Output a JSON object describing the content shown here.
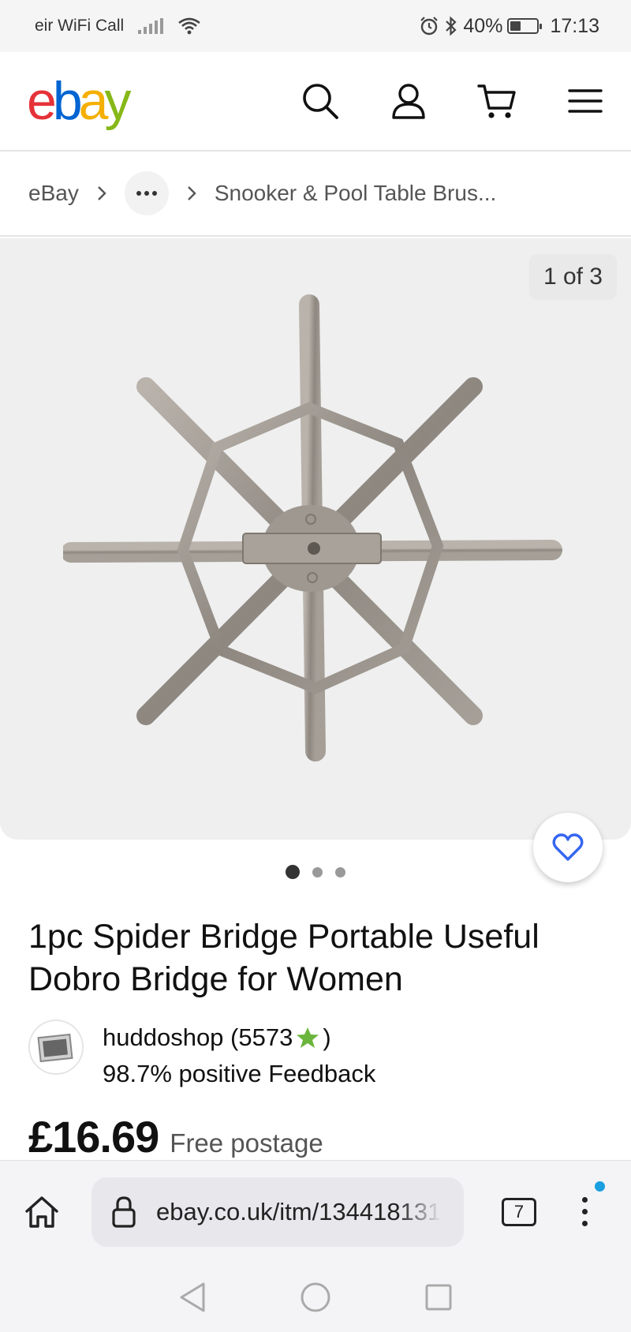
{
  "status_bar": {
    "carrier": "eir WiFi Call",
    "battery_percent": "40%",
    "battery_level": 0.4,
    "time": "17:13",
    "icons": [
      "signal-icon",
      "wifi-icon",
      "alarm-icon",
      "bluetooth-icon",
      "battery-icon"
    ]
  },
  "header": {
    "logo_letters": [
      "e",
      "b",
      "a",
      "y"
    ],
    "logo_colors": [
      "#e53238",
      "#0064d2",
      "#f5af02",
      "#86b817"
    ],
    "icons": [
      "search-icon",
      "account-icon",
      "cart-icon",
      "menu-icon"
    ]
  },
  "breadcrumb": {
    "items": [
      "eBay",
      "Snooker & Pool Table Brus..."
    ]
  },
  "gallery": {
    "counter": "1 of 3",
    "image_count": 3,
    "active_index": 0
  },
  "listing": {
    "title": "1pc Spider Bridge Portable Useful Dobro Bridge for Women",
    "seller_name": "huddoshop (5573",
    "seller_suffix": ")",
    "feedback": "98.7% positive Feedback",
    "price": "£16.69",
    "postage": "Free postage"
  },
  "browser": {
    "url": "ebay.co.uk/itm/134418131",
    "tab_count": "7"
  },
  "colors": {
    "accent_blue": "#3665f3",
    "star_green": "#6ab53c",
    "notification": "#1a9fe0"
  }
}
